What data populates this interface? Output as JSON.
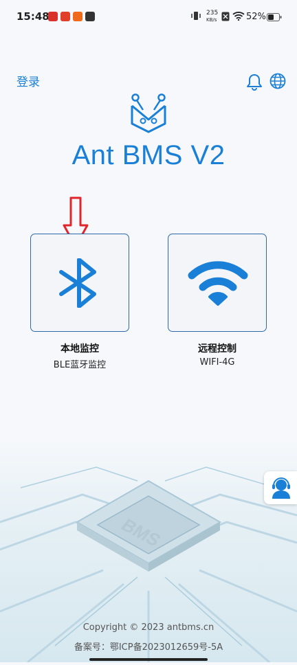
{
  "status_bar": {
    "time": "15:48",
    "net_speed_value": "235",
    "net_speed_unit": "KB/s",
    "battery": "52%"
  },
  "header": {
    "login_label": "登录",
    "app_title": "Ant BMS V2"
  },
  "cards": [
    {
      "title": "本地监控",
      "subtitle": "BLE蓝牙监控"
    },
    {
      "title": "远程控制",
      "subtitle": "WIFI-4G"
    }
  ],
  "footer": {
    "copyright": "Copyright © 2023 antbms.cn",
    "icp": "备案号：鄂ICP备2023012659号-5A"
  },
  "colors": {
    "accent": "#1a7fd6",
    "arrow": "#e0252b",
    "card_border": "#2a6aa8"
  }
}
